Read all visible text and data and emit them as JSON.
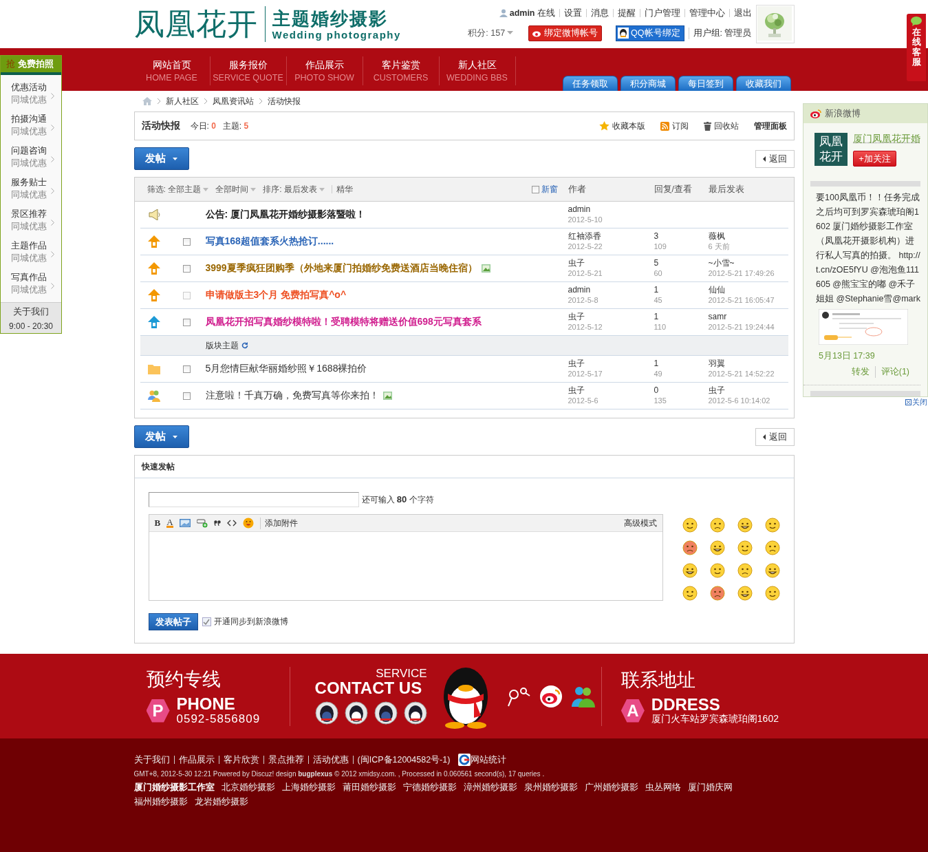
{
  "header": {
    "logo": "凤凰花开",
    "theme": "主题婚纱摄影",
    "theme_en": "Wedding photography",
    "user": "admin",
    "status": "在线",
    "links": [
      "设置",
      "消息",
      "提醒",
      "门户管理",
      "管理中心",
      "退出"
    ],
    "points": "积分: 157",
    "bind_weibo": "绑定微博帐号",
    "bind_qq": "QQ帐号绑定",
    "usergroup": "用户组: 管理员"
  },
  "service_tab": "在线客服",
  "nav": [
    {
      "label": "网站首页",
      "en": "HOME PAGE"
    },
    {
      "label": "服务报价",
      "en": "SERVICE QUOTE"
    },
    {
      "label": "作品展示",
      "en": "PHOTO SHOW"
    },
    {
      "label": "客片鉴赏",
      "en": "CUSTOMERS"
    },
    {
      "label": "新人社区",
      "en": "WEDDING BBS"
    }
  ],
  "nav_tabs": [
    "任务领取",
    "积分商城",
    "每日签到",
    "收藏我们"
  ],
  "promo": {
    "badge": "抢",
    "title": "免费拍照",
    "items": [
      {
        "title": "优惠活动",
        "sub": "同城优惠"
      },
      {
        "title": "拍摄沟通",
        "sub": "同城优惠"
      },
      {
        "title": "问题咨询",
        "sub": "同城优惠"
      },
      {
        "title": "服务贴士",
        "sub": "同城优惠"
      },
      {
        "title": "景区推荐",
        "sub": "同城优惠"
      },
      {
        "title": "主题作品",
        "sub": "同城优惠"
      },
      {
        "title": "写真作品",
        "sub": "同城优惠"
      }
    ],
    "about": "关于我们",
    "hours": "9:00 - 20:30"
  },
  "breadcrumb": [
    "新人社区",
    "凤凰资讯站",
    "活动快报"
  ],
  "forum": {
    "name": "活动快报",
    "today_label": "今日:",
    "today": "0",
    "topics_label": "主题:",
    "topics": "5",
    "actions": [
      {
        "kind": "star",
        "label": "收藏本版"
      },
      {
        "kind": "rss",
        "label": "订阅"
      },
      {
        "kind": "trash",
        "label": "回收站"
      },
      {
        "kind": "plain",
        "label": "管理面板"
      }
    ]
  },
  "top_actions": {
    "post": "发帖",
    "back": "返回"
  },
  "threads": {
    "filters": [
      {
        "label": "筛选: 全部主题",
        "dropdown": true
      },
      {
        "label": "全部时间",
        "dropdown": true
      },
      {
        "label": "排序: 最后发表",
        "dropdown": true
      },
      {
        "label": "精华",
        "dropdown": false
      }
    ],
    "new_window": {
      "label": "新窗",
      "checked": false
    },
    "columns": [
      "作者",
      "回复/查看",
      "最后发表"
    ],
    "rows": [
      {
        "kind": "announcement",
        "title": "公告: 厦门凤凰花开婚纱摄影落暨啦！",
        "color": "#222222",
        "author": "admin",
        "date": "2012-5-10"
      },
      {
        "kind": "sticky-global",
        "title": "写真168超值套系火热抢订......",
        "color": "#2b65b7",
        "has_image": false,
        "checked": false,
        "disabled": false,
        "author": "红袖添香",
        "date": "2012-5-22",
        "replies": "3",
        "views": "109",
        "last_user": "薇枫",
        "last_time": "6 天前"
      },
      {
        "kind": "sticky-global",
        "title": "3999夏季疯狂团购季（外地来厦门拍婚纱免费送酒店当晚住宿）",
        "color": "#996600",
        "has_image": true,
        "checked": false,
        "disabled": false,
        "author": "虫子",
        "date": "2012-5-21",
        "replies": "5",
        "views": "60",
        "last_user": "~小雪~",
        "last_time": "2012-5-21 17:49:26"
      },
      {
        "kind": "sticky-global",
        "title": "申请做版主3个月 免费拍写真^o^",
        "color": "#ee5023",
        "has_image": false,
        "checked": false,
        "disabled": true,
        "author": "admin",
        "date": "2012-5-8",
        "replies": "1",
        "views": "45",
        "last_user": "仙仙",
        "last_time": "2012-5-21 16:05:47"
      },
      {
        "kind": "sticky-category",
        "title": "凤凰花开招写真婚纱模特啦！受聘模特将赠送价值698元写真套系",
        "color": "#d01d8e",
        "has_image": false,
        "checked": false,
        "disabled": false,
        "author": "虫子",
        "date": "2012-5-12",
        "replies": "1",
        "views": "110",
        "last_user": "samr",
        "last_time": "2012-5-21 19:24:44"
      },
      {
        "kind": "separator",
        "title": "版块主题"
      },
      {
        "kind": "folder",
        "title": "5月您情巨献华丽婚纱照￥1688裸拍价",
        "color": "#333333",
        "has_image": false,
        "checked": false,
        "disabled": false,
        "author": "虫子",
        "date": "2012-5-17",
        "replies": "1",
        "views": "49",
        "last_user": "羽翼",
        "last_time": "2012-5-21 14:52:22"
      },
      {
        "kind": "people",
        "title": "注意啦！千真万确，免费写真等你来拍！",
        "color": "#333333",
        "has_image": true,
        "checked": false,
        "disabled": false,
        "author": "虫子",
        "date": "2012-5-6",
        "replies": "0",
        "views": "135",
        "last_user": "虫子",
        "last_time": "2012-5-6 10:14:02"
      }
    ]
  },
  "bottom_actions": {
    "post": "发帖",
    "back": "返回"
  },
  "quick_post": {
    "title": "快速发帖",
    "counter_label": "还可输入",
    "count": "80",
    "counter_unit": "个字符",
    "bold_button": "B",
    "color_button": "A",
    "attach": "添加附件",
    "advanced": "高级模式",
    "submit": "发表帖子",
    "sync": {
      "label": "开通同步到新浪微博",
      "checked": true,
      "disabled": true
    }
  },
  "weibo": {
    "header": "新浪微博",
    "avatar_text": "凤凰花开",
    "account": "厦门凤凰花开婚",
    "follow": "+加关注",
    "post": "要100凤凰币！！任务完成之后均可到罗宾森琥珀阁1602 厦门婚纱摄影工作室（凤凰花开摄影机构）进行私人写真的拍摄。 http://t.cn/zOE5fYU @泡泡鱼111605 @熊宝宝的嘟 @禾子姐姐 @Stephanie雪@mark",
    "time": "5月13日 17:39",
    "forward": "转发",
    "comment": "评论(1)",
    "close": "关闭"
  },
  "footer": {
    "phone_title": "预约专线",
    "phone_badge": "P",
    "phone_label": "PHONE",
    "phone": "0592-5856809",
    "service": "SERVICE",
    "contact": "CONTACT US",
    "address_title": "联系地址",
    "address_badge": "A",
    "address_label": "DDRESS",
    "address": "厦门火车站罗宾森琥珀阁1602",
    "links": [
      "关于我们",
      "作品展示",
      "客片欣赏",
      "景点推荐",
      "活动优惠",
      "(闽ICP备12004582号-1)"
    ],
    "stats": "网站统计",
    "powered": "GMT+8, 2012-5-30 12:21 Powered by Discuz! design **bugplexus** © 2012 xmidsy.com. , Processed in 0.060561 second(s), 17 queries .",
    "studio": "厦门婚纱摄影工作室",
    "friend_links": [
      "北京婚纱摄影",
      "上海婚纱摄影",
      "莆田婚纱摄影",
      "宁德婚纱摄影",
      "漳州婚纱摄影",
      "泉州婚纱摄影",
      "广州婚纱摄影",
      "虫丛网络",
      "厦门婚庆网",
      "福州婚纱摄影",
      "龙岩婚纱摄影"
    ]
  }
}
